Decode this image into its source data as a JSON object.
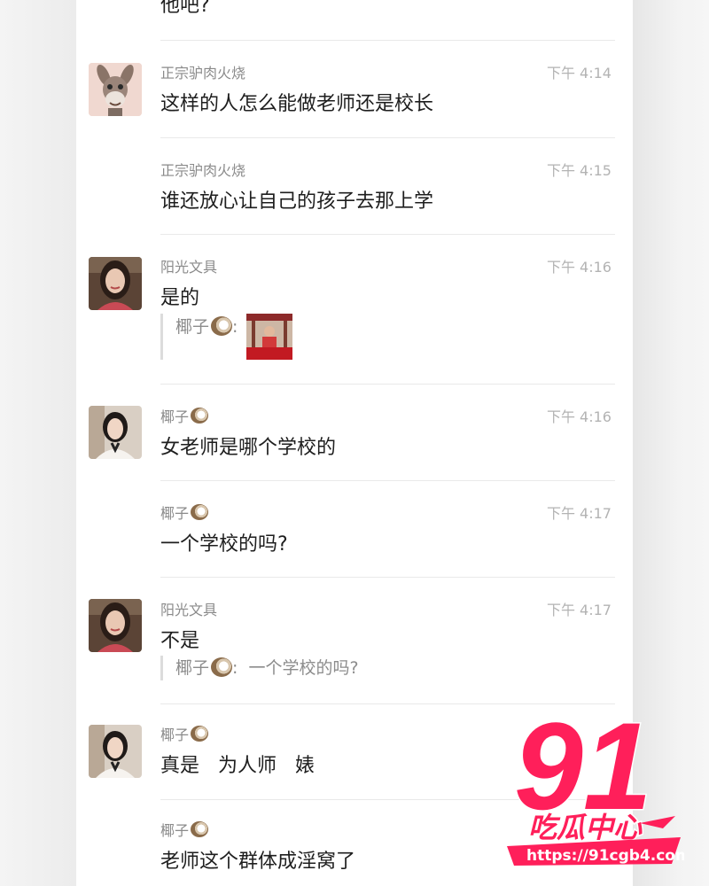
{
  "top_fragment": "他吧?",
  "messages": [
    {
      "sender": "正宗驴肉火烧",
      "time": "下午 4:14",
      "text": "这样的人怎么能做老师还是校长",
      "avatar": "donkey"
    },
    {
      "sender": "正宗驴肉火烧",
      "time": "下午 4:15",
      "text": "谁还放心让自己的孩子去那上学",
      "avatar": ""
    },
    {
      "sender": "阳光文具",
      "time": "下午 4:16",
      "text": "是的",
      "avatar": "woman-long-hair",
      "quote": {
        "author": "椰子",
        "separator": ":",
        "attachment": "image"
      }
    },
    {
      "sender": "椰子",
      "time": "下午 4:16",
      "text": "女老师是哪个学校的",
      "avatar": "woman-short-hair"
    },
    {
      "sender": "椰子",
      "time": "下午 4:17",
      "text": "一个学校的吗?",
      "avatar": ""
    },
    {
      "sender": "阳光文具",
      "time": "下午 4:17",
      "text": "不是",
      "avatar": "woman-long-hair",
      "quote": {
        "author": "椰子",
        "separator": ":",
        "content": "一个学校的吗?"
      }
    },
    {
      "sender": "椰子",
      "time": "",
      "text": "真是   为人师   婊",
      "avatar": "woman-short-hair"
    },
    {
      "sender": "椰子",
      "time": "",
      "text": "老师这个群体成淫窝了",
      "avatar": ""
    }
  ],
  "watermark": {
    "number": "91",
    "name": "吃瓜中心",
    "url": "https://91cgb4.com",
    "color": "#ff1f5a"
  },
  "icons": {
    "coconut_emoji": "coconut-icon"
  }
}
